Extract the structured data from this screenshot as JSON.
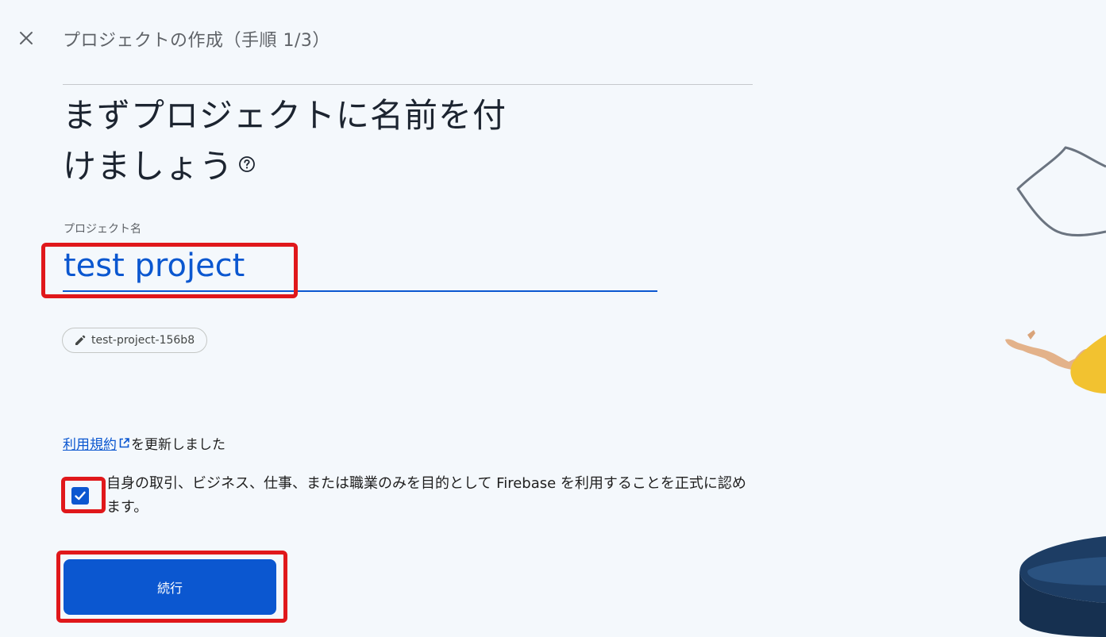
{
  "header": {
    "title": "プロジェクトの作成（手順 1/3）",
    "close_icon": "close-icon"
  },
  "main": {
    "headline_line1": "まずプロジェクトに名前を付",
    "headline_line2": "けましょう",
    "help_icon": "help-circle-icon",
    "project_name_label": "プロジェクト名",
    "project_name_value": "test project",
    "project_id": "test-project-156b8",
    "terms_link": "利用規約",
    "terms_suffix": "を更新しました",
    "confirm_text": "自身の取引、ビジネス、仕事、または職業のみを目的として Firebase を利用することを正式に認めます。",
    "confirm_checked": true,
    "continue_label": "続行"
  },
  "colors": {
    "accent": "#0b57d0",
    "highlight": "#e0181b",
    "background": "#f4f8fc"
  }
}
